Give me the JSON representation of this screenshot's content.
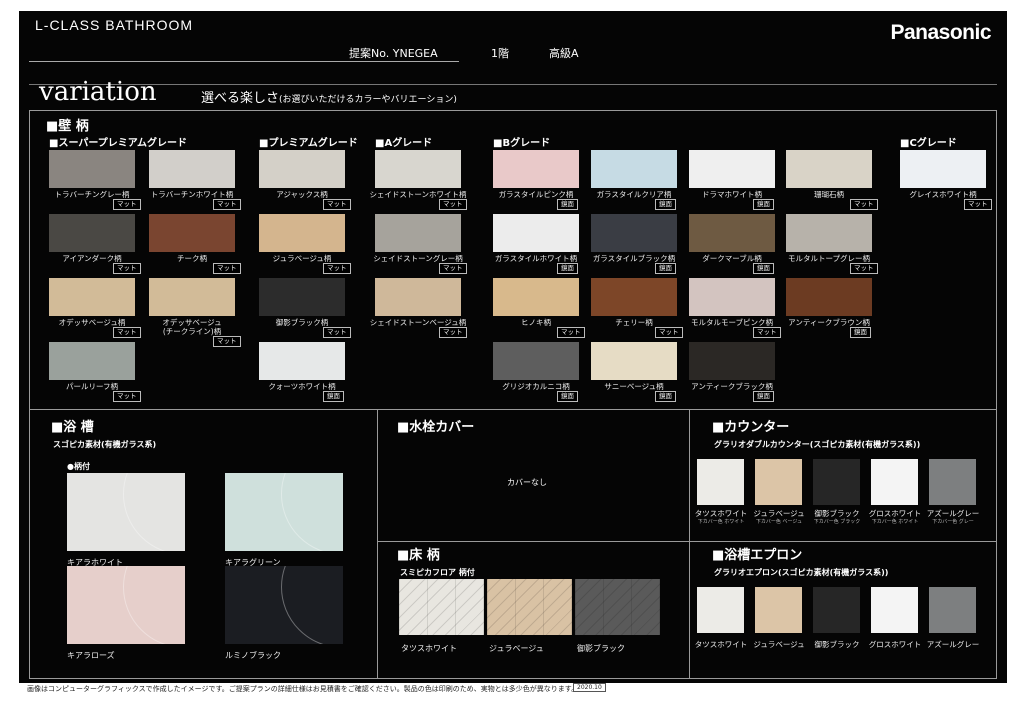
{
  "header": {
    "brand_title": "L-CLASS BATHROOM",
    "proposal_no": "提案No. YNEGEA",
    "floor": "1階",
    "grade": "高級A",
    "logo": "Panasonic"
  },
  "title": {
    "main": "variation",
    "sub": "選べる楽しさ",
    "sub_note": "(お選びいただけるカラーやバリエーション)"
  },
  "wall": {
    "heading": "■壁 柄",
    "groups": {
      "super_premium": "■スーパープレミアムグレード",
      "premium": "■プレミアムグレード",
      "a": "■Aグレード",
      "b": "■Bグレード",
      "c": "■Cグレード"
    },
    "swatches": [
      {
        "name": "トラバーチングレー柄",
        "finish": "マット",
        "color": "#8a8580"
      },
      {
        "name": "トラバーチンホワイト柄",
        "finish": "マット",
        "color": "#d2cfca"
      },
      {
        "name": "アイアンダーク柄",
        "finish": "マット",
        "color": "#4a4844"
      },
      {
        "name": "チーク柄",
        "finish": "マット",
        "color": "#7a4530"
      },
      {
        "name": "オデッサベージュ柄",
        "finish": "マット",
        "color": "#d2bb98"
      },
      {
        "name": "オデッサベージュ",
        "name2": "(チークライン)柄",
        "finish": "マット",
        "color": "#d2bb98"
      },
      {
        "name": "パールリーフ柄",
        "finish": "マット",
        "color": "#9aa19c"
      },
      {
        "name": "アジャックス柄",
        "finish": "マット",
        "color": "#d4d0c8"
      },
      {
        "name": "ジュラベージュ柄",
        "finish": "マット",
        "color": "#d4b58e"
      },
      {
        "name": "御影ブラック柄",
        "finish": "マット",
        "color": "#2c2c2c"
      },
      {
        "name": "クォーツホワイト柄",
        "finish": "鏡面",
        "color": "#e6e8e8"
      },
      {
        "name": "シェイドストーンホワイト柄",
        "finish": "マット",
        "color": "#d8d6cf"
      },
      {
        "name": "シェイドストーングレー柄",
        "finish": "マット",
        "color": "#a6a39c"
      },
      {
        "name": "シェイドストーンベージュ柄",
        "finish": "マット",
        "color": "#cfb89a"
      },
      {
        "name": "ガラスタイルピンク柄",
        "finish": "鏡面",
        "color": "#e9c9c9"
      },
      {
        "name": "ガラスタイルクリア柄",
        "finish": "鏡面",
        "color": "#c6dbe4"
      },
      {
        "name": "ドラマホワイト柄",
        "finish": "鏡面",
        "color": "#efefef"
      },
      {
        "name": "珊瑚石柄",
        "finish": "マット",
        "color": "#d9d3c7"
      },
      {
        "name": "ガラスタイルホワイト柄",
        "finish": "鏡面",
        "color": "#ececec"
      },
      {
        "name": "ガラスタイルブラック柄",
        "finish": "鏡面",
        "color": "#3a3d44"
      },
      {
        "name": "ダークマーブル柄",
        "finish": "鏡面",
        "color": "#6e5a42"
      },
      {
        "name": "モルタルトープグレー柄",
        "finish": "マット",
        "color": "#b7b2aa"
      },
      {
        "name": "ヒノキ柄",
        "finish": "マット",
        "color": "#d8b98c"
      },
      {
        "name": "チェリー柄",
        "finish": "マット",
        "color": "#7d4628"
      },
      {
        "name": "モルタルモーブピンク柄",
        "finish": "マット",
        "color": "#d3c4c0"
      },
      {
        "name": "アンティークブラウン柄",
        "finish": "鏡面",
        "color": "#6c3b22"
      },
      {
        "name": "グリジオカルニコ柄",
        "finish": "鏡面",
        "color": "#5e5e5e"
      },
      {
        "name": "サニーベージュ柄",
        "finish": "鏡面",
        "color": "#e6dcc5"
      },
      {
        "name": "アンティークブラック柄",
        "finish": "鏡面",
        "color": "#2b2825"
      },
      {
        "name": "グレイスホワイト柄",
        "finish": "マット",
        "color": "#edf0f3"
      }
    ]
  },
  "bathtub": {
    "heading": "■浴 槽",
    "material": "スゴピカ素材(有機ガラス系)",
    "pattern": "●柄付",
    "items": [
      {
        "name": "キアラホワイト",
        "color": "#e4e4e2"
      },
      {
        "name": "キアラグリーン",
        "color": "#cfe0dc"
      },
      {
        "name": "キアラローズ",
        "color": "#e6cfcb"
      },
      {
        "name": "ルミノブラック",
        "color": "#1b1d22"
      }
    ]
  },
  "faucet_cover": {
    "heading": "■水栓カバー",
    "value": "カバーなし"
  },
  "floor": {
    "heading": "■床 柄",
    "material": "スミピカフロア 柄付",
    "items": [
      {
        "name": "タツスホワイト",
        "color": "#e8e6e0"
      },
      {
        "name": "ジュラベージュ",
        "color": "#d9c2a4"
      },
      {
        "name": "御影ブラック",
        "color": "#5a5a5a"
      }
    ]
  },
  "counter": {
    "heading": "■カウンター",
    "material": "グラリオダブルカウンター(スゴピカ素材(有機ガラス系))",
    "items": [
      {
        "name": "タツスホワイト",
        "sub": "下カバー色 ホワイト",
        "color": "#ecebe7"
      },
      {
        "name": "ジュラベージュ",
        "sub": "下カバー色 ベージュ",
        "color": "#dcc5a7"
      },
      {
        "name": "御影ブラック",
        "sub": "下カバー色 ブラック",
        "color": "#262626"
      },
      {
        "name": "グロスホワイト",
        "sub": "下カバー色 ホワイト",
        "color": "#f4f4f4"
      },
      {
        "name": "アズールグレー",
        "sub": "下カバー色 グレー",
        "color": "#7d7f80"
      }
    ]
  },
  "apron": {
    "heading": "■浴槽エプロン",
    "material": "グラリオエプロン(スゴピカ素材(有機ガラス系))",
    "items": [
      {
        "name": "タツスホワイト",
        "color": "#ecebe7"
      },
      {
        "name": "ジュラベージュ",
        "color": "#dcc5a7"
      },
      {
        "name": "御影ブラック",
        "color": "#262626"
      },
      {
        "name": "グロスホワイト",
        "color": "#f4f4f4"
      },
      {
        "name": "アズールグレー",
        "color": "#7d7f80"
      }
    ]
  },
  "footer": {
    "note": "画像はコンピューターグラフィックスで作成したイメージです。ご提案プランの詳細仕様はお見積書をご確認ください。製品の色は印刷のため、実物とは多少色が異なります。",
    "date": "2020.10"
  }
}
